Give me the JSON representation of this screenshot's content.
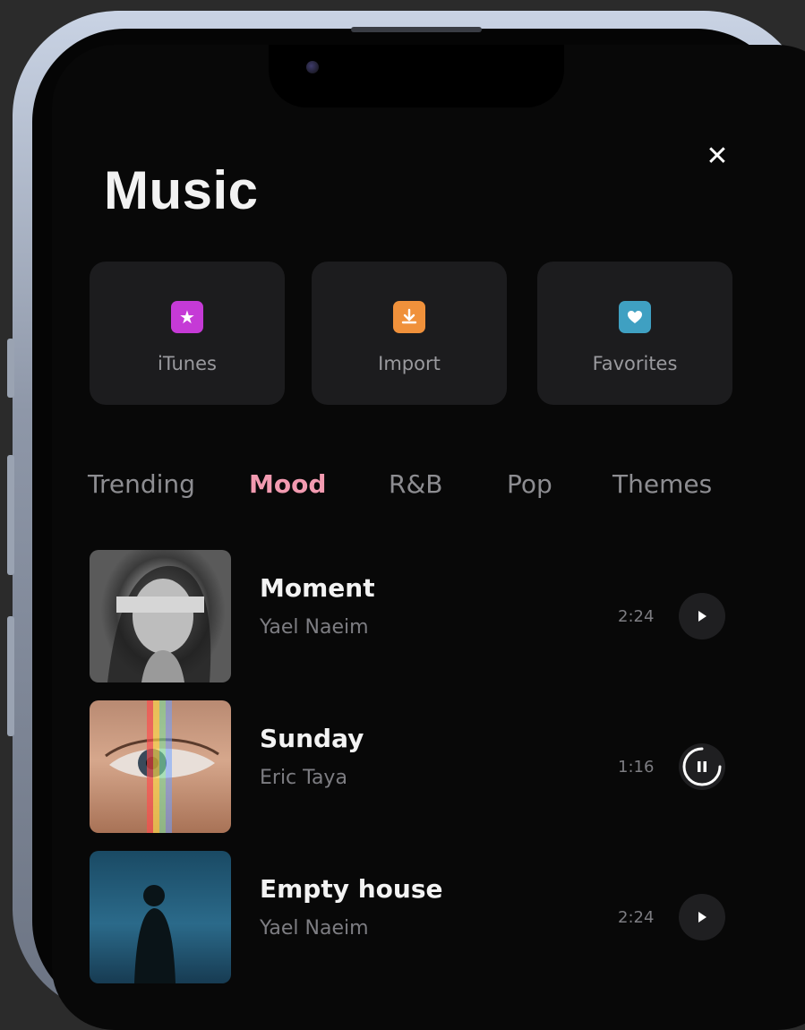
{
  "header": {
    "title": "Music",
    "close_icon": "close-icon"
  },
  "sources": [
    {
      "label": "iTunes",
      "icon": "star-icon",
      "color": "#c53ad6"
    },
    {
      "label": "Import",
      "icon": "download-icon",
      "color": "#f0913b"
    },
    {
      "label": "Favorites",
      "icon": "heart-icon",
      "color": "#3fa0c2"
    }
  ],
  "tabs": [
    {
      "label": "Trending",
      "active": false
    },
    {
      "label": "Mood",
      "active": true
    },
    {
      "label": "R&B",
      "active": false
    },
    {
      "label": "Pop",
      "active": false
    },
    {
      "label": "Themes",
      "active": false
    }
  ],
  "tracks": [
    {
      "title": "Moment",
      "artist": "Yael Naeim",
      "duration": "2:24",
      "state": "play"
    },
    {
      "title": "Sunday",
      "artist": "Eric Taya",
      "duration": "1:16",
      "state": "pause"
    },
    {
      "title": "Empty house",
      "artist": "Yael Naeim",
      "duration": "2:24",
      "state": "play"
    }
  ],
  "colors": {
    "accent": "#f29ab0",
    "background": "#080808",
    "tile": "#1c1c1e"
  }
}
